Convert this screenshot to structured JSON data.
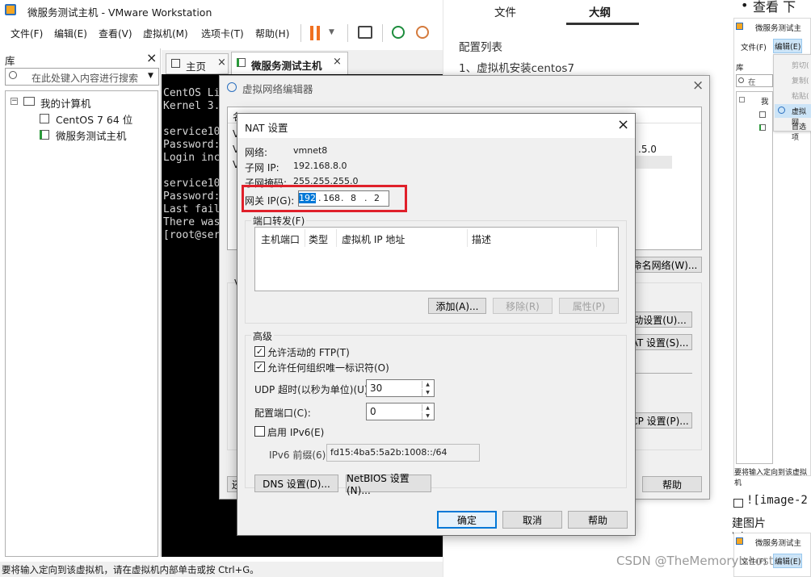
{
  "vmware": {
    "title": "微服务测试主机 - VMware Workstation",
    "menu": [
      "文件(F)",
      "编辑(E)",
      "查看(V)",
      "虚拟机(M)",
      "选项卡(T)",
      "帮助(H)"
    ],
    "library": {
      "title": "库",
      "close": "×",
      "search_placeholder": "在此处键入内容进行搜索",
      "tree": {
        "root": "我的计算机",
        "items": [
          "CentOS 7 64 位",
          "微服务测试主机"
        ]
      }
    },
    "tabs": {
      "home": "主页",
      "vm": "微服务测试主机"
    },
    "console_lines": [
      "CentOS Li",
      "Kernel 3.",
      "",
      "service10",
      "Password:",
      "Login inc",
      "",
      "service10",
      "Password:",
      "Last fail",
      "There was",
      "[root@ser"
    ],
    "status": "要将输入定向到该虚拟机，请在虚拟机内部单击或按 Ctrl+G。"
  },
  "doc": {
    "tabs": [
      "文件",
      "大纲"
    ],
    "heading": "配置列表",
    "item1": "1、虚拟机安装centos7",
    "bullet_top": "查看 下",
    "image_text1": "![image-2",
    "image_text2": "建图片\\image-",
    "watermark": "CSDN @TheMemoryIsLost"
  },
  "side_thumb": {
    "title": "微服务测试主",
    "menu": [
      "文件(F)",
      "编辑(E)"
    ],
    "lib": "库",
    "search": "在",
    "menu_items": [
      "剪切(",
      "复制(",
      "粘贴(",
      "虚拟网",
      "首选项"
    ],
    "tree": "我",
    "status": "要将输入定向到该虚拟机",
    "bottom_title": "微服务测试主",
    "bottom_menu": [
      "文件(F)",
      "编辑(E)"
    ]
  },
  "vne": {
    "title": "虚拟网络编辑器",
    "col_head": "名",
    "rows_partial": [
      "V",
      "V",
      "V"
    ],
    "cell_partial": ".5.0",
    "btn_rename": "命名网络(W)...",
    "btn_auto": "动设置(U)...",
    "btn_nat": "AT 设置(S)...",
    "btn_dhcp": "CP 设置(P)...",
    "btn_restore": "还",
    "btn_help": "帮助"
  },
  "nat": {
    "title": "NAT 设置",
    "network_label": "网络:",
    "network_value": "vmnet8",
    "subnet_ip_label": "子网 IP:",
    "subnet_ip_value": "192.168.8.0",
    "mask_label": "子网掩码:",
    "mask_value": "255.255.255.0",
    "gateway_label": "网关 IP(G):",
    "gateway_octets": [
      "192",
      "168",
      "8",
      "2"
    ],
    "port_forward_title": "端口转发(F)",
    "columns": [
      "主机端口",
      "类型",
      "虚拟机 IP 地址",
      "描述"
    ],
    "btn_add": "添加(A)...",
    "btn_remove": "移除(R)",
    "btn_props": "属性(P)",
    "advanced_title": "高级",
    "allow_ftp": "允许活动的 FTP(T)",
    "allow_uid": "允许任何组织唯一标识符(O)",
    "udp_label": "UDP 超时(以秒为单位)(U):",
    "udp_value": "30",
    "cfg_port_label": "配置端口(C):",
    "cfg_port_value": "0",
    "ipv6_label": "启用 IPv6(E)",
    "ipv6_prefix_label": "IPv6 前缀(6):",
    "ipv6_prefix_value": "fd15:4ba5:5a2b:1008::/64",
    "btn_dns": "DNS 设置(D)...",
    "btn_netbios": "NetBIOS 设置(N)...",
    "btn_ok": "确定",
    "btn_cancel": "取消",
    "btn_help": "帮助"
  },
  "colors": {
    "highlight_box": "#e0202a",
    "selection": "#0078d7",
    "dialog_bg": "#f0f0f0"
  }
}
